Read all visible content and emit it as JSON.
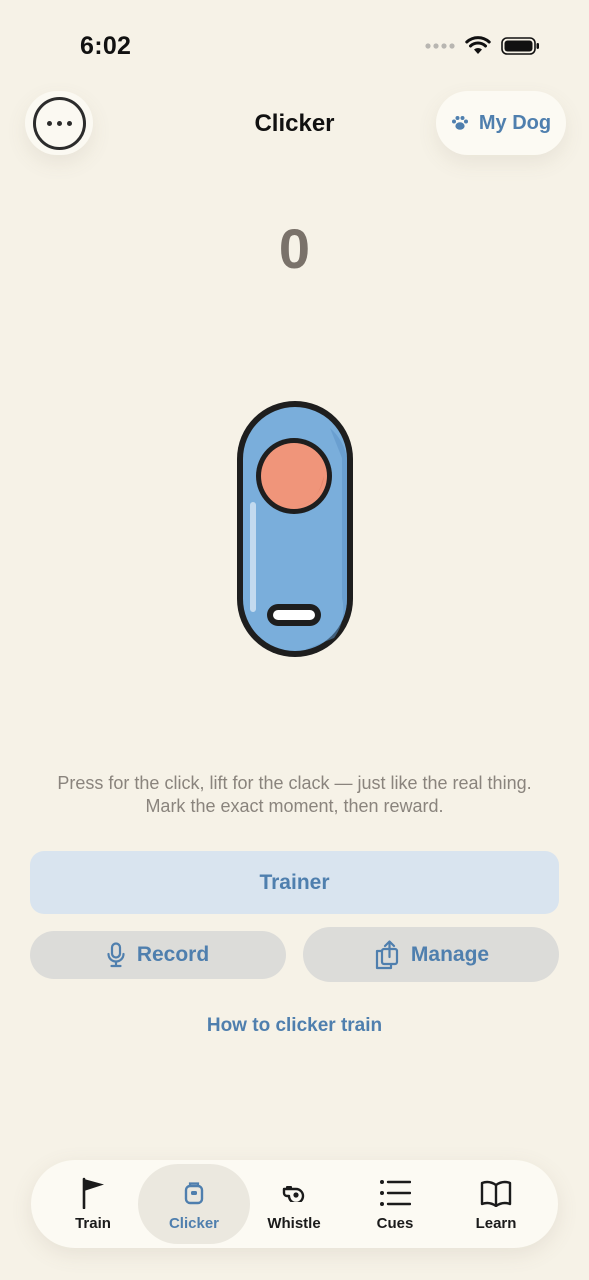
{
  "status_bar": {
    "time": "6:02",
    "icons": [
      "signal-dots-icon",
      "wifi-icon",
      "battery-icon"
    ]
  },
  "header": {
    "title": "Clicker",
    "menu_icon": "more-options-icon",
    "profile_label": "My Dog",
    "profile_icon": "paw-icon"
  },
  "counter": {
    "value": "0"
  },
  "clicker": {
    "icon": "clicker-device-icon",
    "colors": {
      "body": "#7aaedb",
      "button": "#f0957a",
      "outline": "#1e1e1e"
    }
  },
  "hint": {
    "text": "Press for the click, lift for the clack — just like the real thing. Mark the exact moment, then reward."
  },
  "actions": {
    "trainer_label": "Trainer",
    "record_label": "Record",
    "record_icon": "microphone-icon",
    "manage_label": "Manage",
    "manage_icon": "share-icon",
    "howto_label": "How to clicker train"
  },
  "tabs": [
    {
      "label": "Train",
      "icon": "flag-icon",
      "active": false
    },
    {
      "label": "Clicker",
      "icon": "clicker-icon",
      "active": true
    },
    {
      "label": "Whistle",
      "icon": "whistle-icon",
      "active": false
    },
    {
      "label": "Cues",
      "icon": "list-icon",
      "active": false
    },
    {
      "label": "Learn",
      "icon": "book-icon",
      "active": false
    }
  ],
  "colors": {
    "background": "#f6f2e7",
    "accent": "#4f7fae",
    "counter": "#7a726a",
    "trainer_button": "#d9e4ef",
    "secondary_button": "#dcdcd9"
  }
}
